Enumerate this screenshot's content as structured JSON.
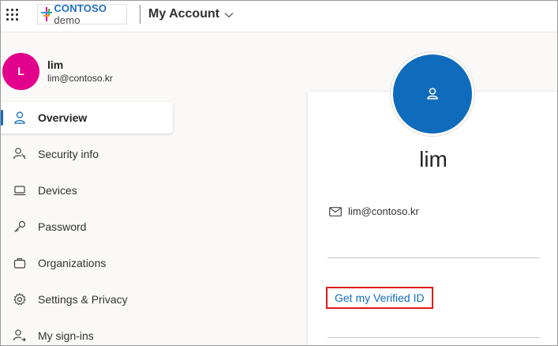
{
  "header": {
    "logo_brand": "CONTOSO",
    "logo_suffix": "demo",
    "app_title": "My Account"
  },
  "user": {
    "initial": "L",
    "name": "lim",
    "email": "lim@contoso.kr"
  },
  "nav": [
    {
      "label": "Overview",
      "icon": "person-icon",
      "active": true
    },
    {
      "label": "Security info",
      "icon": "person-key-icon"
    },
    {
      "label": "Devices",
      "icon": "laptop-icon"
    },
    {
      "label": "Password",
      "icon": "key-icon"
    },
    {
      "label": "Organizations",
      "icon": "briefcase-icon"
    },
    {
      "label": "Settings & Privacy",
      "icon": "gear-icon"
    },
    {
      "label": "My sign-ins",
      "icon": "person-arrow-icon"
    }
  ],
  "profile": {
    "name": "lim",
    "email": "lim@contoso.kr",
    "verified_id_link": "Get my Verified ID"
  },
  "colors": {
    "accent": "#0f6cbd",
    "avatar_small": "#e3008c",
    "highlight_box": "#e01b1b"
  }
}
